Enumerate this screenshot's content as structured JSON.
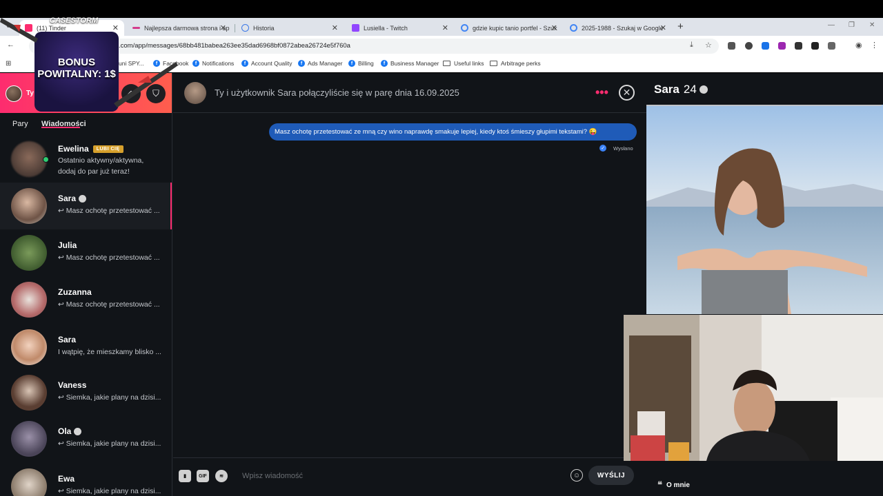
{
  "browser": {
    "tabs": [
      {
        "label": "(11) Tinder",
        "color": "#fd2c6f"
      },
      {
        "label": "Najlepsza darmowa strona i ap",
        "color": "#d43c8c"
      },
      {
        "label": "Historia",
        "color": "#3b78e7"
      },
      {
        "label": "Lusiella - Twitch",
        "color": "#9146ff"
      },
      {
        "label": "gdzie kupic tanio portfel - Szuk",
        "color": "#4285f4"
      },
      {
        "label": "2025-1988 - Szukaj w Google",
        "color": "#4285f4"
      }
    ],
    "url": ".com/app/messages/68bb481babea263ee35dad6968bf0872abea26724e5f760a",
    "bookmarks": [
      {
        "label": "uni SPY...",
        "icon": "link-icon"
      },
      {
        "label": "Facebook",
        "icon": "facebook-icon"
      },
      {
        "label": "Notifications",
        "icon": "facebook-icon"
      },
      {
        "label": "Account Quality",
        "icon": "facebook-icon"
      },
      {
        "label": "Ads Manager",
        "icon": "facebook-icon"
      },
      {
        "label": "Billing",
        "icon": "facebook-icon"
      },
      {
        "label": "Business Manager",
        "icon": "facebook-icon"
      },
      {
        "label": "Useful links",
        "icon": "folder-icon"
      },
      {
        "label": "Arbitrage perks",
        "icon": "folder-icon"
      }
    ]
  },
  "overlay": {
    "brand": "CASESTORM",
    "promo": "BONUS POWITALNY: 1$"
  },
  "sidebar": {
    "you_label": "Ty",
    "tabs": {
      "matches": "Pary",
      "messages": "Wiadomości"
    },
    "conversations": [
      {
        "name": "Ewelina",
        "badge": "LUBI CIĘ",
        "message": "Ostatnio aktywny/aktywna, dodaj do par już teraz!",
        "verified": false,
        "online": true
      },
      {
        "name": "Sara",
        "message": "↩ Masz ochotę przetestować ...",
        "verified": true
      },
      {
        "name": "Julia",
        "message": "↩ Masz ochotę przetestować ...",
        "verified": false
      },
      {
        "name": "Zuzanna",
        "message": "↩ Masz ochotę przetestować ...",
        "verified": false
      },
      {
        "name": "Sara",
        "message": "I wątpię, że mieszkamy blisko ...",
        "verified": false
      },
      {
        "name": "Vaness",
        "message": "↩ Siemka, jakie plany na dzisi...",
        "verified": false
      },
      {
        "name": "Ola",
        "message": "↩ Siemka, jakie plany na dzisi...",
        "verified": true
      },
      {
        "name": "Ewa",
        "message": "↩ Siemka, jakie plany na dzisi...",
        "verified": false
      }
    ]
  },
  "chat": {
    "header": "Ty i użytkownik Sara połączyliście się w parę dnia 16.09.2025",
    "message": "Masz ochotę przetestować ze mną czy wino naprawdę smakuje lepiej, kiedy ktoś śmieszy głupimi tekstami? 😜",
    "status": "Wysłano",
    "placeholder": "Wpisz wiadomość",
    "send": "WYŚLIJ",
    "gif": "GIF"
  },
  "profile": {
    "name": "Sara",
    "age": "24",
    "about": "O mnie"
  },
  "colors": {
    "brand": "#fd2c6f",
    "bubble": "#1f5bb8"
  }
}
